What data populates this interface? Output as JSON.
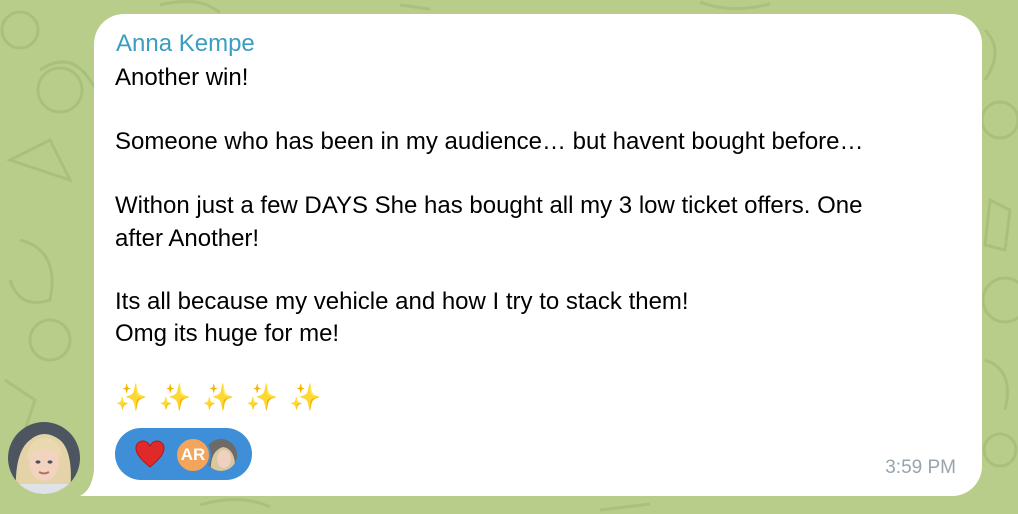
{
  "message": {
    "sender": "Anna Kempe",
    "lines": [
      "Another win!",
      "Someone who has been in my audience… but havent bought before…",
      "Withon just a few DAYS She has bought all my 3 low ticket offers. One",
      "after Another!",
      "Its all because my vehicle and how I try to stack them!",
      "Omg its huge for me!"
    ],
    "emoji": "✨ ✨ ✨ ✨ ✨",
    "timestamp": "3:59 PM"
  },
  "reactions": {
    "emoji": "heart",
    "reactor_initials": "AR"
  },
  "colors": {
    "wallpaper": "#b9cd8a",
    "sender_name": "#3a9ec2",
    "reaction_pill": "#3f8ed8",
    "initials_avatar": "#f3a55b",
    "timestamp": "#98a4ad"
  }
}
